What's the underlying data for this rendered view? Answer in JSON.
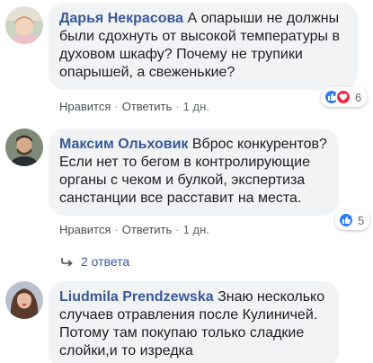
{
  "comments": [
    {
      "author": "Дарья Некрасова",
      "text": "А опарыши не должны были сдохнуть от высокой температуры в духовом шкафу? Почему не трупики опарышей, а свеженькие?",
      "like_label": "Нравится",
      "reply_label": "Ответить",
      "time": "1 дн.",
      "reaction_count": "6",
      "reaction_icons": [
        "like-icon",
        "love-icon"
      ]
    },
    {
      "author": "Максим Ольховик",
      "text": "Вброс конкурентов? Если нет то бегом в контролирующие органы с чеком и булкой, экспертиза санстанции все расставит на места.",
      "like_label": "Нравится",
      "reply_label": "Ответить",
      "time": "1 дн.",
      "reaction_count": "5",
      "reaction_icons": [
        "like-icon"
      ]
    },
    {
      "author": "Liudmila Prendzewska",
      "text": "Знаю несколько случаев отравления после Кулиничей. Потому там покупаю только сладкие слойки,и то изредка"
    }
  ],
  "replies_link": "2 ответа",
  "colors": {
    "author": "#385898",
    "bubble": "#f2f3f5",
    "like": "#2f7bf6",
    "love": "#f0284a"
  }
}
